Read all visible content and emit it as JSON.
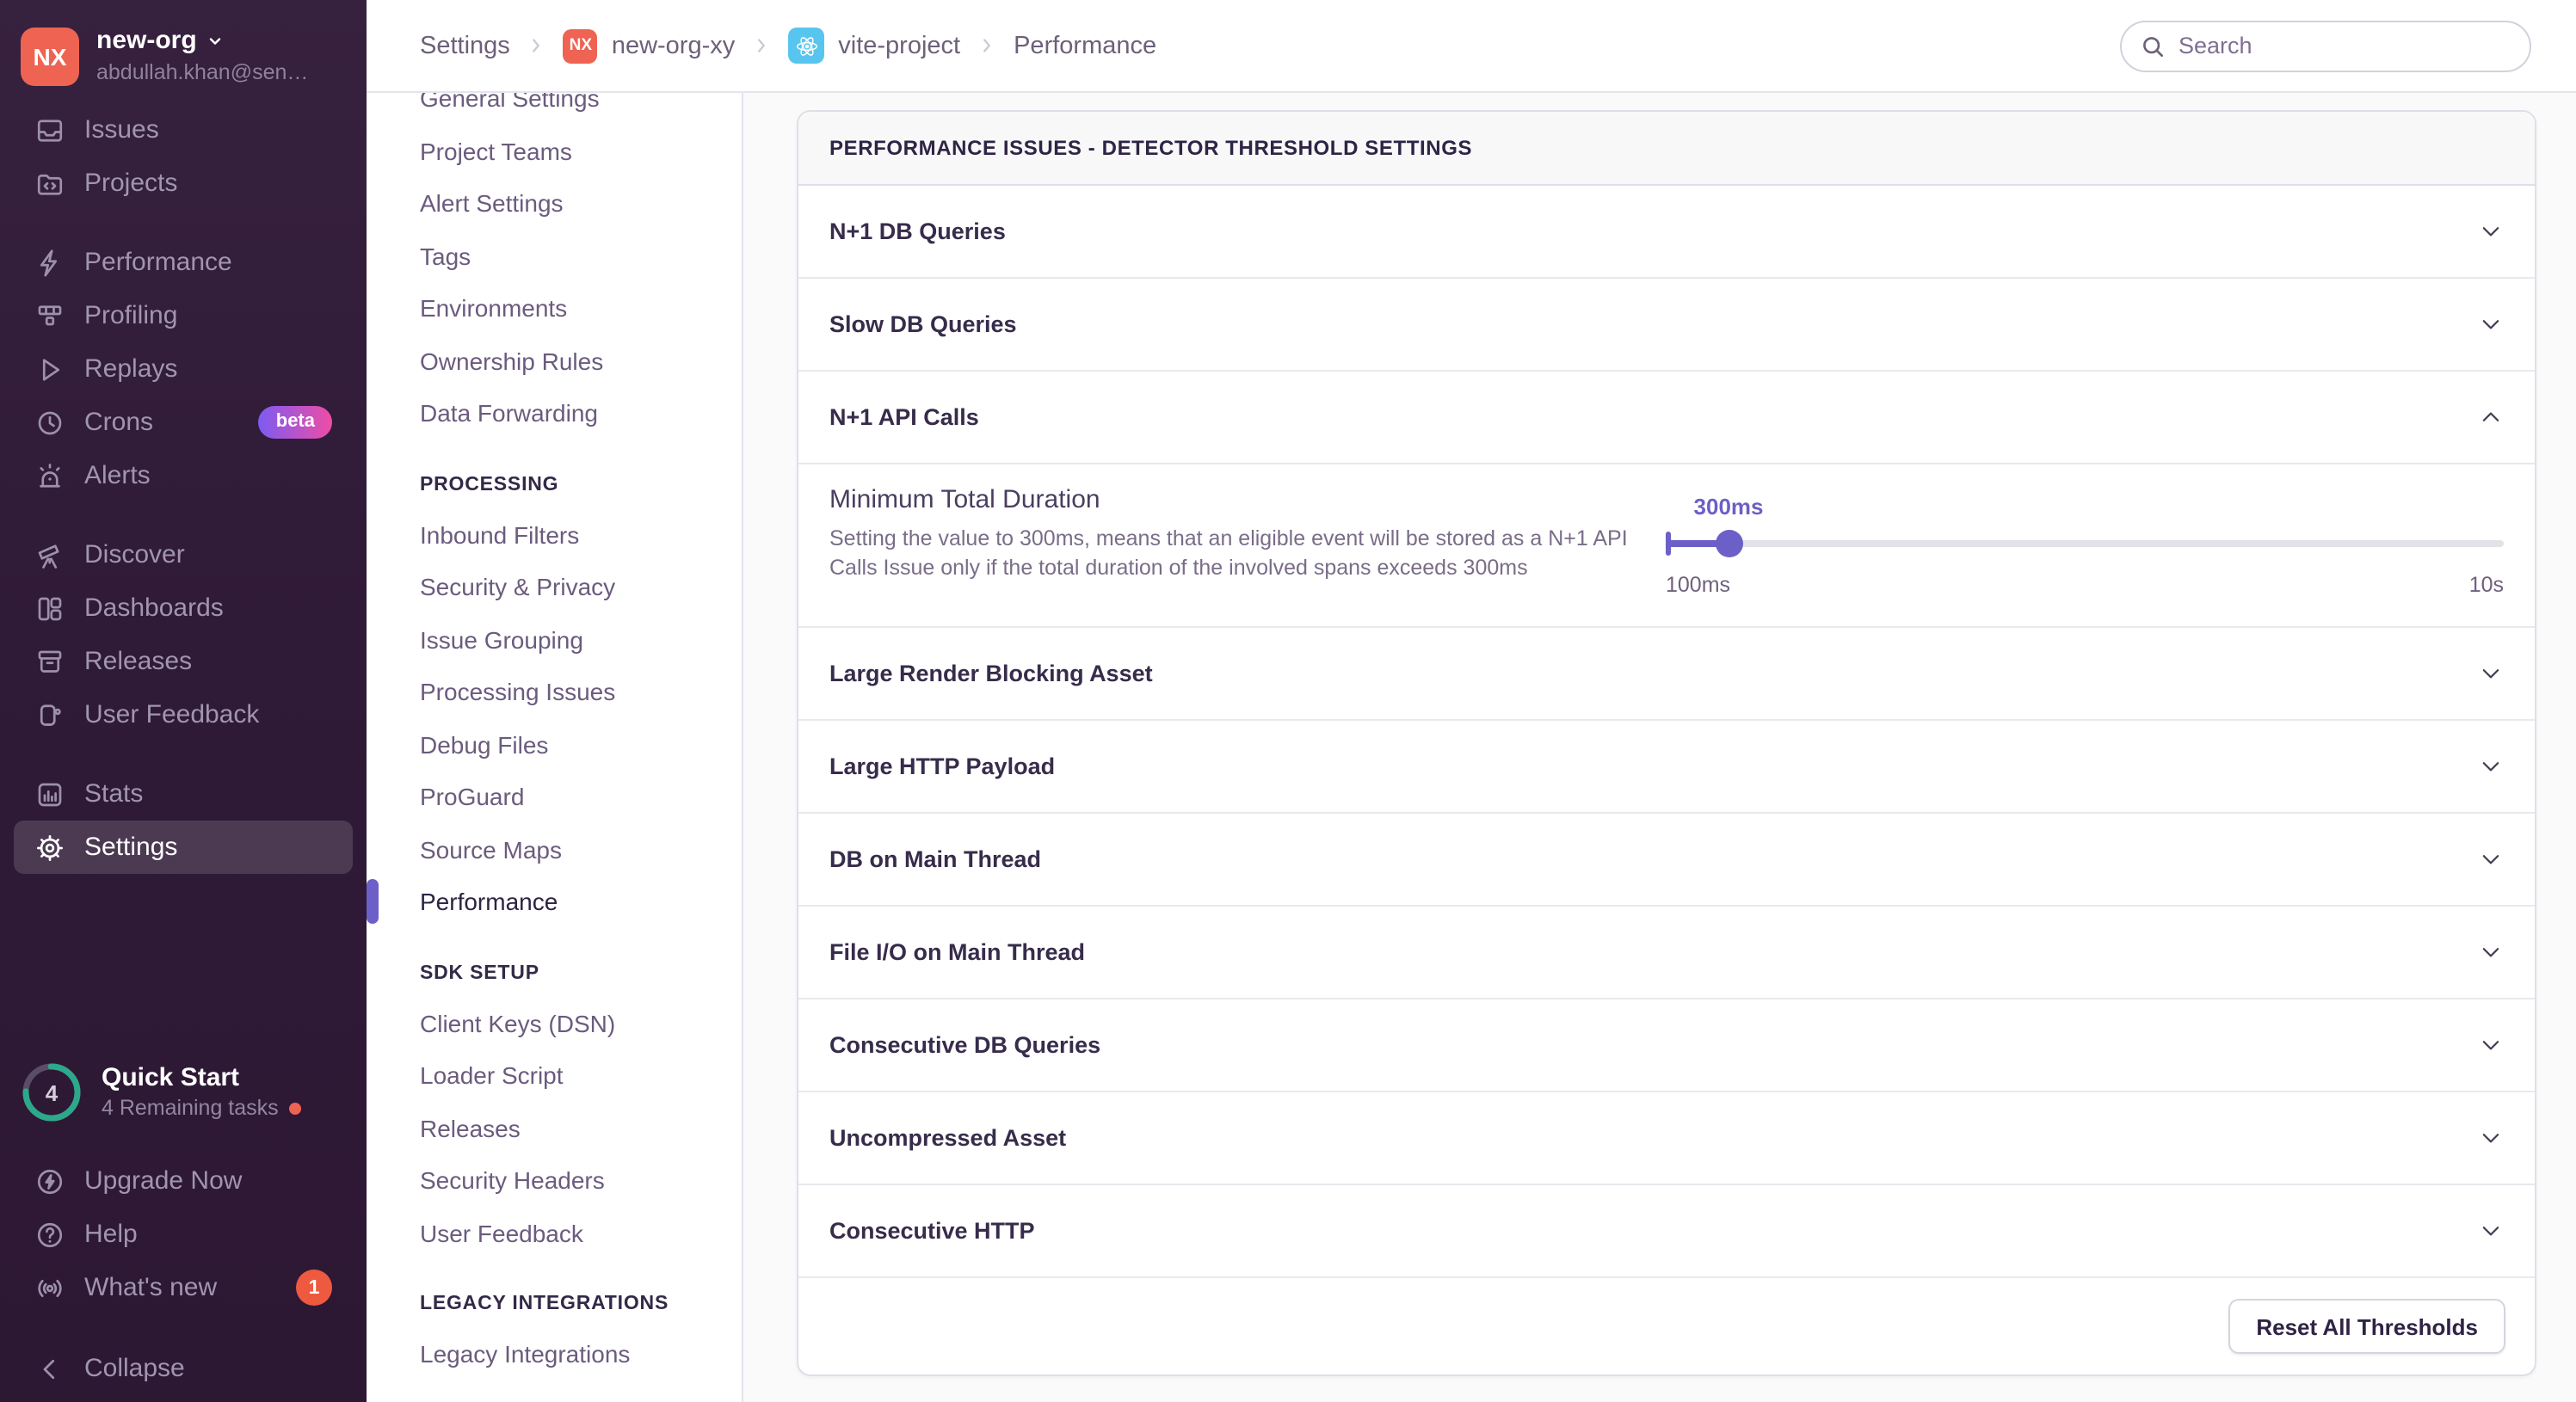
{
  "colors": {
    "accent": "#6c5fc7",
    "sidebar_bg": "#2f1a37",
    "org_avatar": "#ee6352",
    "react_badge": "#58c5ee",
    "badge_red": "#ee5a3f",
    "ring_teal": "#2ca98b"
  },
  "sidebar": {
    "org": {
      "initials": "NX",
      "name": "new-org",
      "email": "abdullah.khan@sen…"
    },
    "primary": [
      {
        "label": "Issues",
        "icon": "issues-icon"
      },
      {
        "label": "Projects",
        "icon": "projects-icon"
      }
    ],
    "observability": [
      {
        "label": "Performance",
        "icon": "performance-icon"
      },
      {
        "label": "Profiling",
        "icon": "profiling-icon"
      },
      {
        "label": "Replays",
        "icon": "replays-icon"
      },
      {
        "label": "Crons",
        "icon": "crons-icon",
        "badge": "beta"
      },
      {
        "label": "Alerts",
        "icon": "alerts-icon"
      }
    ],
    "explore": [
      {
        "label": "Discover",
        "icon": "discover-icon"
      },
      {
        "label": "Dashboards",
        "icon": "dashboards-icon"
      },
      {
        "label": "Releases",
        "icon": "releases-icon"
      },
      {
        "label": "User Feedback",
        "icon": "user-feedback-icon"
      }
    ],
    "manage": [
      {
        "label": "Stats",
        "icon": "stats-icon"
      },
      {
        "label": "Settings",
        "icon": "settings-icon"
      }
    ],
    "quickstart": {
      "count": "4",
      "title": "Quick Start",
      "subtitle": "4 Remaining tasks"
    },
    "footer": [
      {
        "label": "Upgrade Now",
        "icon": "upgrade-icon"
      },
      {
        "label": "Help",
        "icon": "help-icon"
      },
      {
        "label": "What's new",
        "icon": "whats-new-icon",
        "badge": "1"
      }
    ],
    "collapse_label": "Collapse"
  },
  "topbar": {
    "breadcrumb": [
      {
        "label": "Settings"
      },
      {
        "label": "new-org-xy",
        "badge": "NX"
      },
      {
        "label": "vite-project",
        "icon": "react-icon"
      },
      {
        "label": "Performance"
      }
    ],
    "search_placeholder": "Search"
  },
  "settings_nav": {
    "project_items": [
      "General Settings",
      "Project Teams",
      "Alert Settings",
      "Tags",
      "Environments",
      "Ownership Rules",
      "Data Forwarding"
    ],
    "processing_title": "PROCESSING",
    "processing_items": [
      "Inbound Filters",
      "Security & Privacy",
      "Issue Grouping",
      "Processing Issues",
      "Debug Files",
      "ProGuard",
      "Source Maps",
      "Performance"
    ],
    "sdk_title": "SDK SETUP",
    "sdk_items": [
      "Client Keys (DSN)",
      "Loader Script",
      "Releases",
      "Security Headers",
      "User Feedback"
    ],
    "legacy_title": "LEGACY INTEGRATIONS",
    "legacy_items": [
      "Legacy Integrations"
    ],
    "active_item": "Performance"
  },
  "main": {
    "panel_title": "PERFORMANCE ISSUES - DETECTOR THRESHOLD SETTINGS",
    "rows": [
      {
        "label": "N+1 DB Queries",
        "expanded": false
      },
      {
        "label": "Slow DB Queries",
        "expanded": false
      },
      {
        "label": "N+1 API Calls",
        "expanded": true
      },
      {
        "label": "Large Render Blocking Asset",
        "expanded": false
      },
      {
        "label": "Large HTTP Payload",
        "expanded": false
      },
      {
        "label": "DB on Main Thread",
        "expanded": false
      },
      {
        "label": "File I/O on Main Thread",
        "expanded": false
      },
      {
        "label": "Consecutive DB Queries",
        "expanded": false
      },
      {
        "label": "Uncompressed Asset",
        "expanded": false
      },
      {
        "label": "Consecutive HTTP",
        "expanded": false
      }
    ],
    "expanded_section": {
      "field_label": "Minimum Total Duration",
      "description": "Setting the value to 300ms, means that an eligible event will be stored as a N+1 API Calls Issue only if the total duration of the involved spans exceeds 300ms",
      "slider": {
        "value_label": "300ms",
        "min_label": "100ms",
        "max_label": "10s",
        "percent": 7.5
      }
    },
    "reset_button": "Reset All Thresholds"
  }
}
